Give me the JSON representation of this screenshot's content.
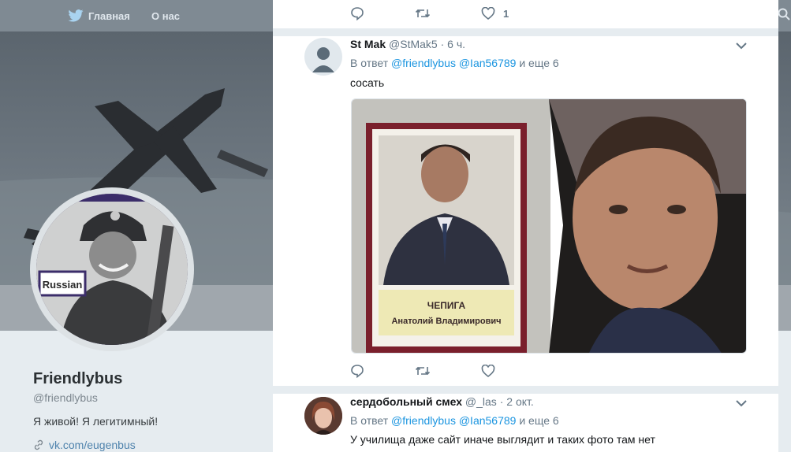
{
  "nav": {
    "home_label": "Главная",
    "about_label": "О нас"
  },
  "profile": {
    "name": "Friendlybus",
    "handle": "@friendlybus",
    "bio": "Я живой! Я легитимный!",
    "link": "vk.com/eugenbus",
    "avatar_caption": "Russian"
  },
  "previous_tweet": {
    "like_count": "1"
  },
  "tweets": [
    {
      "name": "St Mak",
      "handle": "@StMak5",
      "time": "6 ч.",
      "reply_prefix": "В ответ",
      "mentions": [
        "@friendlybus",
        "@Ian56789"
      ],
      "reply_more": "и еще 6",
      "text": "сосать",
      "media": {
        "placard_line1": "ЧЕПИГА",
        "placard_line2": "Анатолий Владимирович"
      }
    },
    {
      "name": "сердобольный смех",
      "handle": "@_las",
      "time": "2 окт.",
      "reply_prefix": "В ответ",
      "mentions": [
        "@friendlybus",
        "@Ian56789"
      ],
      "reply_more": "и еще 6",
      "text": "У училища даже сайт иначе выглядит и таких фото там нет"
    }
  ],
  "colors": {
    "accent": "#1b95e0",
    "muted": "#657786",
    "divider": "#e6ecf0"
  }
}
